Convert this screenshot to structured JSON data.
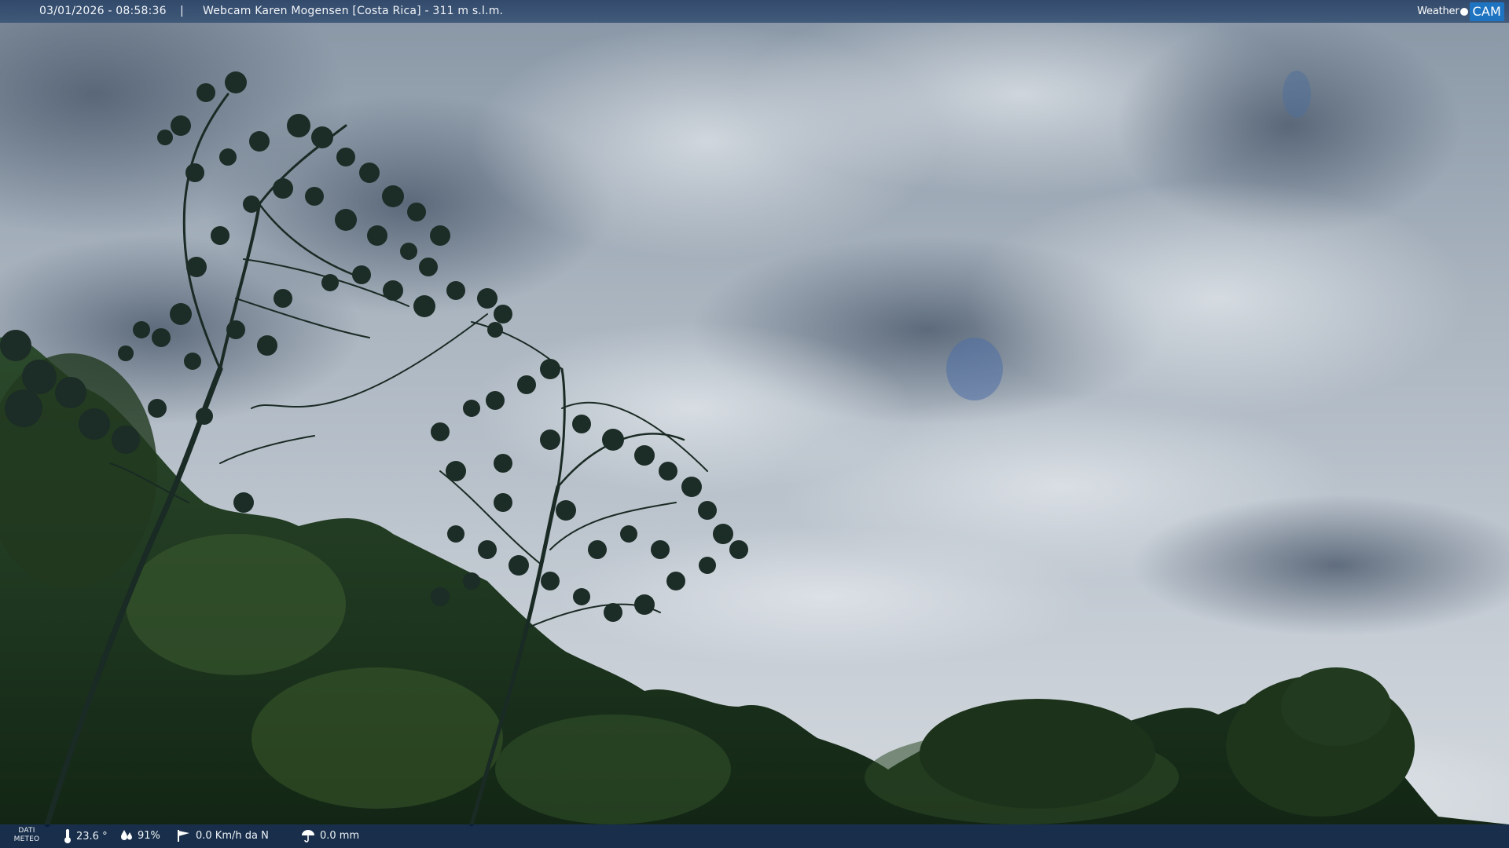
{
  "header": {
    "datetime": "03/01/2026 - 08:58:36",
    "separator": "|",
    "title": "Webcam Karen Mogensen [Costa Rica]  - 311 m s.l.m."
  },
  "logo": {
    "weather": "Weather",
    "cam": "CAM"
  },
  "weather_bar": {
    "label_line1": "DATI",
    "label_line2": "METEO",
    "temperature": "23.6 °",
    "humidity": "91%",
    "wind": "0.0 Km/h da N",
    "rain": "0.0 mm"
  },
  "scene": {
    "description_icons": [
      "thermometer-icon",
      "humidity-icon",
      "wind-icon",
      "rain-icon"
    ],
    "colors": {
      "sky": "#c3ccd4",
      "cloud_dark": "#5f6e80",
      "foliage": "#1d3520",
      "bar": "#0a203e",
      "accent": "#1f74c2"
    }
  }
}
